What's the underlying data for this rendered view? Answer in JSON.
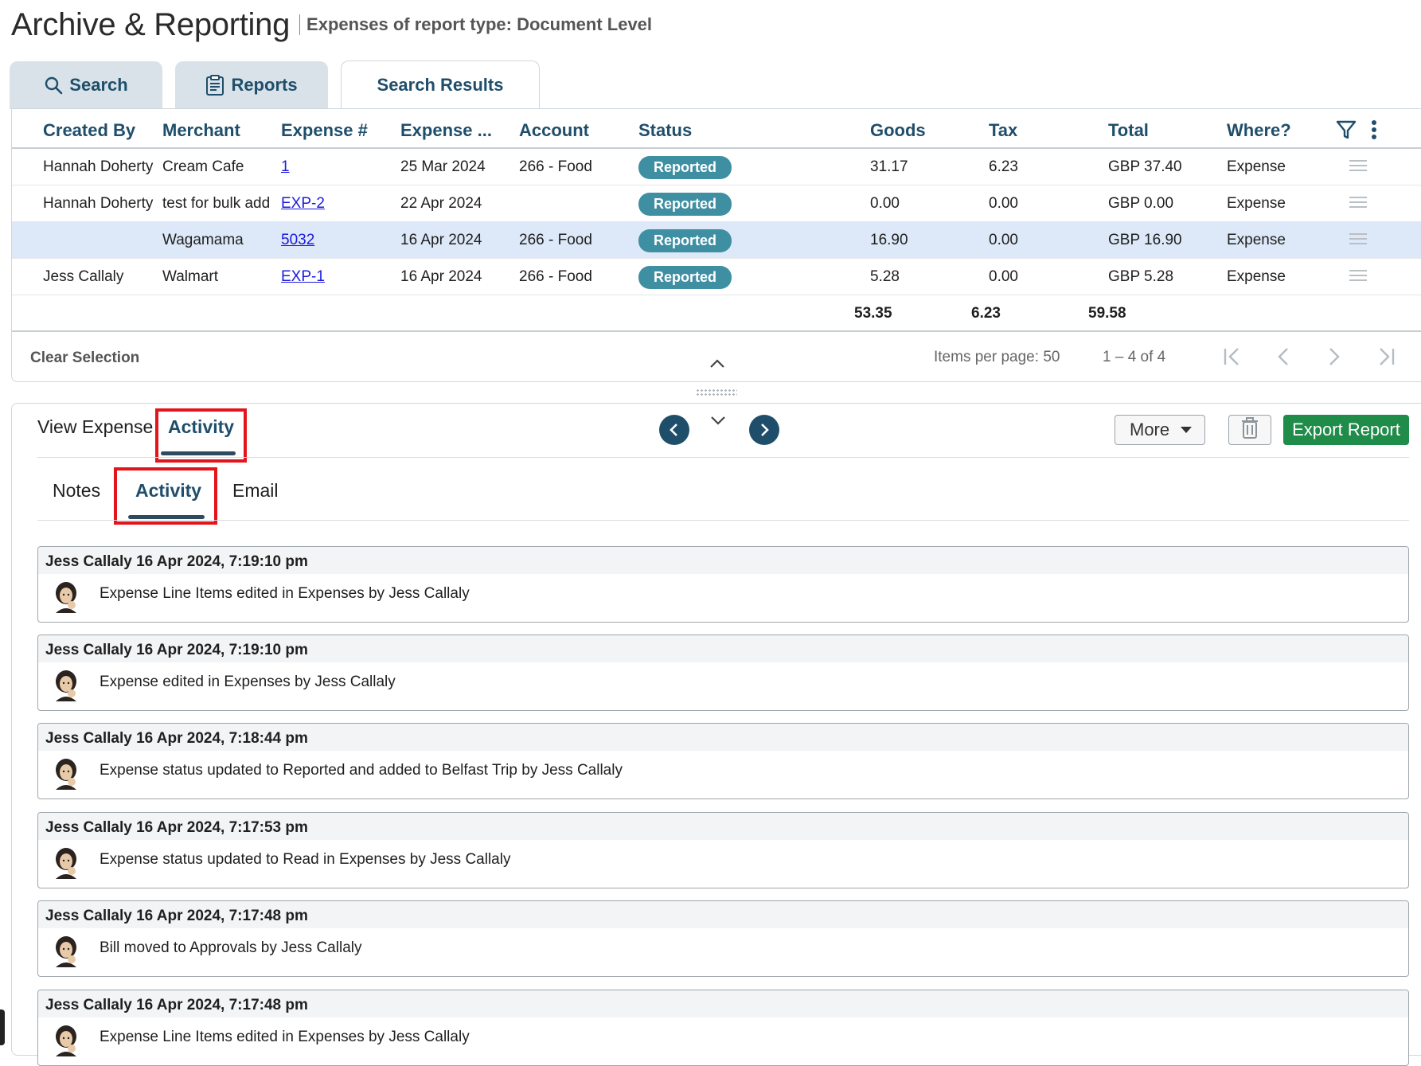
{
  "header": {
    "title": "Archive & Reporting",
    "subtitle": "Expenses of report type: Document Level"
  },
  "tabs": [
    {
      "label": "Search",
      "icon": "search-icon"
    },
    {
      "label": "Reports",
      "icon": "clipboard-icon"
    },
    {
      "label": "Search Results"
    }
  ],
  "grid": {
    "columns": [
      "Created By",
      "Merchant",
      "Expense #",
      "Expense ...",
      "Account",
      "Status",
      "Goods",
      "Tax",
      "Total",
      "Where?"
    ],
    "rows": [
      {
        "created_by": "Hannah Doherty",
        "merchant": "Cream Cafe",
        "expense_no": "1",
        "date": "25 Mar 2024",
        "account": "266 - Food",
        "status": "Reported",
        "goods": "31.17",
        "tax": "6.23",
        "total": "GBP 37.40",
        "where": "Expense"
      },
      {
        "created_by": "Hannah Doherty",
        "merchant": "test for bulk add",
        "expense_no": "EXP-2",
        "date": "22 Apr 2024",
        "account": "",
        "status": "Reported",
        "goods": "0.00",
        "tax": "0.00",
        "total": "GBP 0.00",
        "where": "Expense"
      },
      {
        "created_by": "",
        "merchant": "Wagamama",
        "expense_no": "5032",
        "date": "16 Apr 2024",
        "account": "266 - Food",
        "status": "Reported",
        "goods": "16.90",
        "tax": "0.00",
        "total": "GBP 16.90",
        "where": "Expense"
      },
      {
        "created_by": "Jess Callaly",
        "merchant": "Walmart",
        "expense_no": "EXP-1",
        "date": "16 Apr 2024",
        "account": "266 - Food",
        "status": "Reported",
        "goods": "5.28",
        "tax": "0.00",
        "total": "GBP 5.28",
        "where": "Expense"
      }
    ],
    "selected_row": 2,
    "totals": {
      "goods": "53.35",
      "tax": "6.23",
      "total": "59.58"
    },
    "status_color": "#3f8fa3"
  },
  "footer": {
    "clear_selection": "Clear Selection",
    "items_per_page_label": "Items per page:",
    "items_per_page": "50",
    "range": "1 – 4 of 4"
  },
  "detail": {
    "tabs": [
      "View Expense",
      "Activity"
    ],
    "active_tab": "Activity",
    "subtabs": [
      "Notes",
      "Activity",
      "Email"
    ],
    "active_subtab": "Activity",
    "more_label": "More",
    "export_label": "Export Report",
    "export_color": "#1f8c4a",
    "activities": [
      {
        "header": "Jess Callaly 16 Apr 2024, 7:19:10 pm",
        "text": "Expense Line Items edited in Expenses by Jess Callaly"
      },
      {
        "header": "Jess Callaly 16 Apr 2024, 7:19:10 pm",
        "text": "Expense edited in Expenses by Jess Callaly"
      },
      {
        "header": "Jess Callaly 16 Apr 2024, 7:18:44 pm",
        "text": "Expense status updated to Reported and added to Belfast Trip by Jess Callaly"
      },
      {
        "header": "Jess Callaly 16 Apr 2024, 7:17:53 pm",
        "text": "Expense status updated to Read in Expenses by Jess Callaly"
      },
      {
        "header": "Jess Callaly 16 Apr 2024, 7:17:48 pm",
        "text": "Bill moved to Approvals by Jess Callaly"
      },
      {
        "header": "Jess Callaly 16 Apr 2024, 7:17:48 pm",
        "text": "Expense Line Items edited in Expenses by Jess Callaly"
      }
    ]
  }
}
